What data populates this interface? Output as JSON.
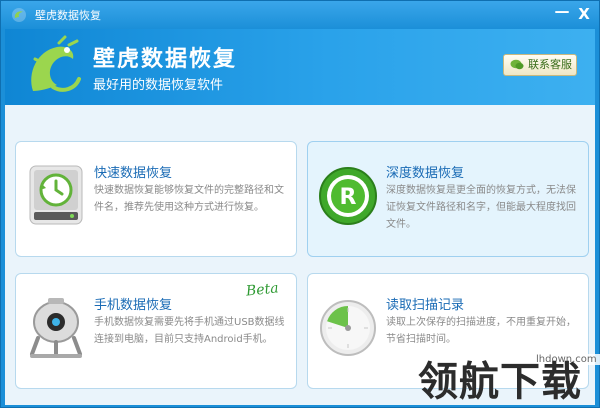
{
  "window": {
    "title": "壁虎数据恢复",
    "minimize_label": "—",
    "close_label": "X"
  },
  "header": {
    "brand_title": "壁虎数据恢复",
    "brand_subtitle": "最好用的数据恢复软件",
    "contact_label": "联系客服"
  },
  "cards": [
    {
      "title": "快速数据恢复",
      "description": "快速数据恢复能够恢复文件的完整路径和文件名，推荐先使用这种方式进行恢复。",
      "icon": "hard-drive-clock-icon"
    },
    {
      "title": "深度数据恢复",
      "description": "深度数据恢复是更全面的恢复方式，无法保证恢复文件路径和名字，但能最大程度找回文件。",
      "icon": "green-r-disc-icon"
    },
    {
      "title": "手机数据恢复",
      "badge": "Beta",
      "description": "手机数据恢复需要先将手机通过USB数据线连接到电脑，目前只支持Android手机。",
      "icon": "robot-icon"
    },
    {
      "title": "读取扫描记录",
      "description": "读取上次保存的扫描进度，不用重复开始，节省扫描时间。",
      "icon": "scan-dial-icon",
      "dial_progress": 0.2
    }
  ],
  "watermark": {
    "url": "lhdown.com",
    "text": "领航下载"
  },
  "colors": {
    "title_bar": "#1b8fd8",
    "header": "#2aa2ea",
    "card_title": "#1a6bb5",
    "card_desc": "#8a8a8a",
    "accent_green": "#2f9a33"
  }
}
